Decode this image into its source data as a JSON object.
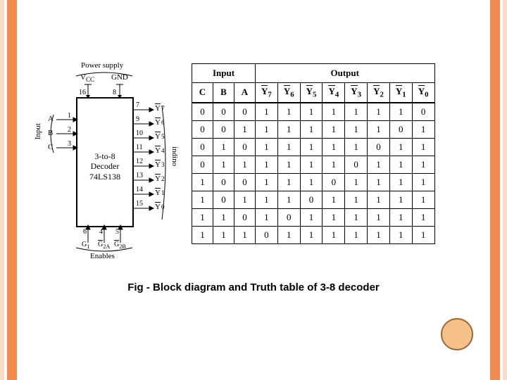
{
  "caption": "Fig - Block diagram and Truth table of 3-8 decoder",
  "block_diagram": {
    "top_label": "Power supply",
    "bottom_label": "Enables",
    "left_side_label": "Input",
    "right_side_label": "indino",
    "chip_line1": "3-to-8",
    "chip_line2": "Decoder",
    "chip_line3": "74LS138",
    "vcc": "V",
    "vcc_sub": "CC",
    "vcc_pin": "16",
    "gnd": "GND",
    "gnd_pin": "8",
    "inputs": [
      {
        "name": "A",
        "pin": "1"
      },
      {
        "name": "B",
        "pin": "2"
      },
      {
        "name": "C",
        "pin": "3"
      }
    ],
    "outputs": [
      {
        "name": "Y",
        "sub": "7",
        "pin": "7"
      },
      {
        "name": "Y",
        "sub": "6",
        "pin": "9"
      },
      {
        "name": "Y",
        "sub": "5",
        "pin": "10"
      },
      {
        "name": "Y",
        "sub": "4",
        "pin": "11"
      },
      {
        "name": "Y",
        "sub": "3",
        "pin": "12"
      },
      {
        "name": "Y",
        "sub": "2",
        "pin": "13"
      },
      {
        "name": "Y",
        "sub": "1",
        "pin": "14"
      },
      {
        "name": "Y",
        "sub": "0",
        "pin": "15"
      }
    ],
    "enables": [
      {
        "name": "G",
        "sub": "1",
        "pin": "6"
      },
      {
        "name": "G",
        "sub": "2A",
        "pin": "4"
      },
      {
        "name": "G",
        "sub": "2B",
        "pin": "5"
      }
    ]
  },
  "truth_table": {
    "section_input": "Input",
    "section_output": "Output",
    "input_cols": [
      "C",
      "B",
      "A"
    ],
    "output_cols": [
      {
        "y": "Y",
        "s": "7"
      },
      {
        "y": "Y",
        "s": "6"
      },
      {
        "y": "Y",
        "s": "5"
      },
      {
        "y": "Y",
        "s": "4"
      },
      {
        "y": "Y",
        "s": "3"
      },
      {
        "y": "Y",
        "s": "2"
      },
      {
        "y": "Y",
        "s": "1"
      },
      {
        "y": "Y",
        "s": "0"
      }
    ],
    "rows": [
      {
        "in": [
          "0",
          "0",
          "0"
        ],
        "out": [
          "1",
          "1",
          "1",
          "1",
          "1",
          "1",
          "1",
          "0"
        ]
      },
      {
        "in": [
          "0",
          "0",
          "1"
        ],
        "out": [
          "1",
          "1",
          "1",
          "1",
          "1",
          "1",
          "0",
          "1"
        ]
      },
      {
        "in": [
          "0",
          "1",
          "0"
        ],
        "out": [
          "1",
          "1",
          "1",
          "1",
          "1",
          "0",
          "1",
          "1"
        ]
      },
      {
        "in": [
          "0",
          "1",
          "1"
        ],
        "out": [
          "1",
          "1",
          "1",
          "1",
          "0",
          "1",
          "1",
          "1"
        ]
      },
      {
        "in": [
          "1",
          "0",
          "0"
        ],
        "out": [
          "1",
          "1",
          "1",
          "0",
          "1",
          "1",
          "1",
          "1"
        ]
      },
      {
        "in": [
          "1",
          "0",
          "1"
        ],
        "out": [
          "1",
          "1",
          "0",
          "1",
          "1",
          "1",
          "1",
          "1"
        ]
      },
      {
        "in": [
          "1",
          "1",
          "0"
        ],
        "out": [
          "1",
          "0",
          "1",
          "1",
          "1",
          "1",
          "1",
          "1"
        ]
      },
      {
        "in": [
          "1",
          "1",
          "1"
        ],
        "out": [
          "0",
          "1",
          "1",
          "1",
          "1",
          "1",
          "1",
          "1"
        ]
      }
    ]
  },
  "chart_data": {
    "type": "table",
    "title": "3-to-8 Decoder 74LS138 truth table",
    "input_columns": [
      "C",
      "B",
      "A"
    ],
    "output_columns": [
      "Y7",
      "Y6",
      "Y5",
      "Y4",
      "Y3",
      "Y2",
      "Y1",
      "Y0"
    ],
    "rows": [
      [
        0,
        0,
        0,
        1,
        1,
        1,
        1,
        1,
        1,
        1,
        0
      ],
      [
        0,
        0,
        1,
        1,
        1,
        1,
        1,
        1,
        1,
        0,
        1
      ],
      [
        0,
        1,
        0,
        1,
        1,
        1,
        1,
        1,
        0,
        1,
        1
      ],
      [
        0,
        1,
        1,
        1,
        1,
        1,
        1,
        0,
        1,
        1,
        1
      ],
      [
        1,
        0,
        0,
        1,
        1,
        1,
        0,
        1,
        1,
        1,
        1
      ],
      [
        1,
        0,
        1,
        1,
        1,
        0,
        1,
        1,
        1,
        1,
        1
      ],
      [
        1,
        1,
        0,
        1,
        0,
        1,
        1,
        1,
        1,
        1,
        1
      ],
      [
        1,
        1,
        1,
        0,
        1,
        1,
        1,
        1,
        1,
        1,
        1
      ]
    ]
  }
}
